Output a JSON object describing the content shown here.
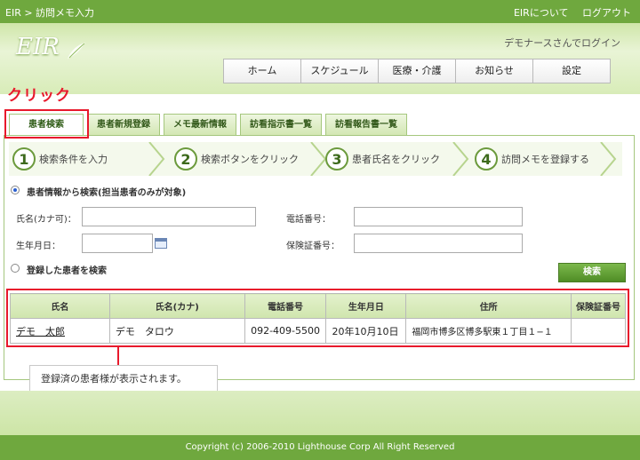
{
  "topbar": {
    "breadcrumb": "EIR > 訪問メモ入力",
    "about_link": "EIRについて",
    "logout_link": "ログアウト"
  },
  "header": {
    "logo": "EIR",
    "login_message": "デモナースさんでログイン",
    "nav": [
      "ホーム",
      "スケジュール",
      "医療・介護",
      "お知らせ",
      "設定"
    ]
  },
  "annotation": {
    "click_label": "クリック",
    "callout": "登録済の患者様が表示されます。"
  },
  "tabs": [
    "患者検索",
    "患者新規登録",
    "メモ最新情報",
    "訪看指示書一覧",
    "訪看報告書一覧"
  ],
  "steps": [
    {
      "num": "1",
      "label": "検索条件を入力"
    },
    {
      "num": "2",
      "label": "検索ボタンをクリック"
    },
    {
      "num": "3",
      "label": "患者氏名をクリック"
    },
    {
      "num": "4",
      "label": "訪問メモを登録する"
    }
  ],
  "search": {
    "option1": "患者情報から検索(担当患者のみが対象)",
    "option2": "登録した患者を検索",
    "name_label": "氏名(カナ可)：",
    "phone_label": "電話番号：",
    "birth_label": "生年月日：",
    "insurance_label": "保険証番号：",
    "button": "検索"
  },
  "results": {
    "headers": [
      "氏名",
      "氏名(カナ)",
      "電話番号",
      "生年月日",
      "住所",
      "保険証番号"
    ],
    "rows": [
      {
        "name": "デモ　太郎",
        "kana": "デモ　タロウ",
        "phone": "092-409-5500",
        "birth": "20年10月10日",
        "address": "福岡市博多区博多駅東１丁目１−１",
        "insurance": ""
      }
    ]
  },
  "footer": {
    "copyright": "Copyright (c) 2006-2010 Lighthouse Corp All Right Reserved"
  },
  "colors": {
    "brand_green": "#6fa83e",
    "highlight_red": "#e8192c"
  }
}
